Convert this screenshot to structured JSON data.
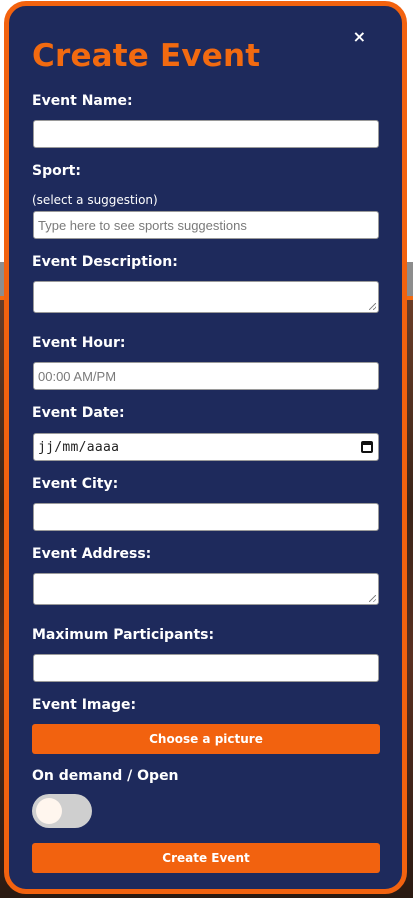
{
  "modal": {
    "title": "Create Event",
    "close_glyph": "×"
  },
  "fields": {
    "event_name": {
      "label": "Event Name:",
      "value": ""
    },
    "sport": {
      "label": "Sport:",
      "hint": "(select a suggestion)",
      "placeholder": "Type here to see sports suggestions"
    },
    "description": {
      "label": "Event Description:",
      "value": ""
    },
    "hour": {
      "label": "Event Hour:",
      "placeholder": "00:00 AM/PM"
    },
    "date": {
      "label": "Event Date:",
      "placeholder": "jj/mm/aaaa"
    },
    "city": {
      "label": "Event City:",
      "value": ""
    },
    "address": {
      "label": "Event Address:",
      "value": ""
    },
    "max_participants": {
      "label": "Maximum Participants:",
      "value": ""
    },
    "image": {
      "label": "Event Image:",
      "button_label": "Choose a picture"
    },
    "mode": {
      "label": "On demand / Open",
      "toggle_on": false
    }
  },
  "actions": {
    "create_label": "Create Event"
  },
  "colors": {
    "modal_bg": "#1e2a5c",
    "accent": "#f2620f",
    "text": "#ffffff"
  },
  "icons": {
    "close": "close-icon",
    "calendar": "calendar-icon"
  }
}
